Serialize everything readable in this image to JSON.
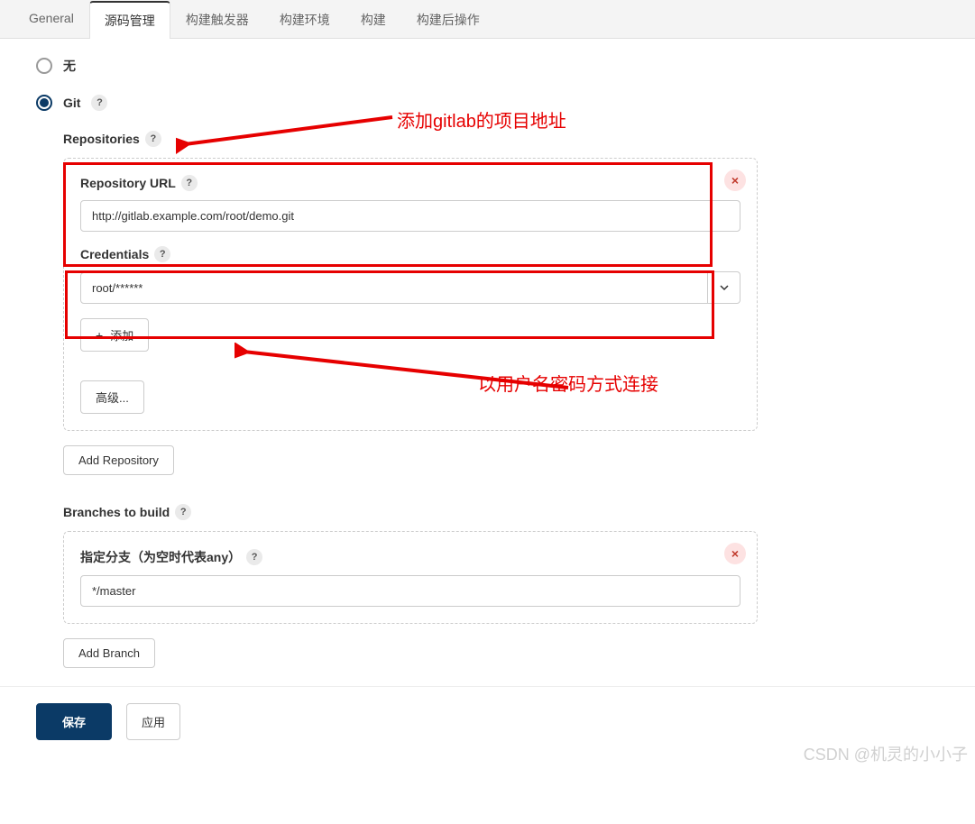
{
  "tabs": {
    "general": "General",
    "scm": "源码管理",
    "triggers": "构建触发器",
    "env": "构建环境",
    "build": "构建",
    "post": "构建后操作"
  },
  "radios": {
    "none": "无",
    "git": "Git"
  },
  "sections": {
    "repositories": "Repositories",
    "repo_url": "Repository URL",
    "credentials": "Credentials",
    "branches": "Branches to build",
    "branch_spec": "指定分支（为空时代表any）"
  },
  "fields": {
    "repo_url": "http://gitlab.example.com/root/demo.git",
    "credential_selected": "root/******",
    "branch_spec": "*/master"
  },
  "buttons": {
    "add": "添加",
    "advanced": "高级...",
    "add_repo": "Add Repository",
    "add_branch": "Add Branch",
    "save": "保存",
    "apply": "应用"
  },
  "annotations": {
    "top": "添加gitlab的项目地址",
    "mid": "以用户名密码方式连接"
  },
  "watermark": "CSDN @机灵的小小子"
}
